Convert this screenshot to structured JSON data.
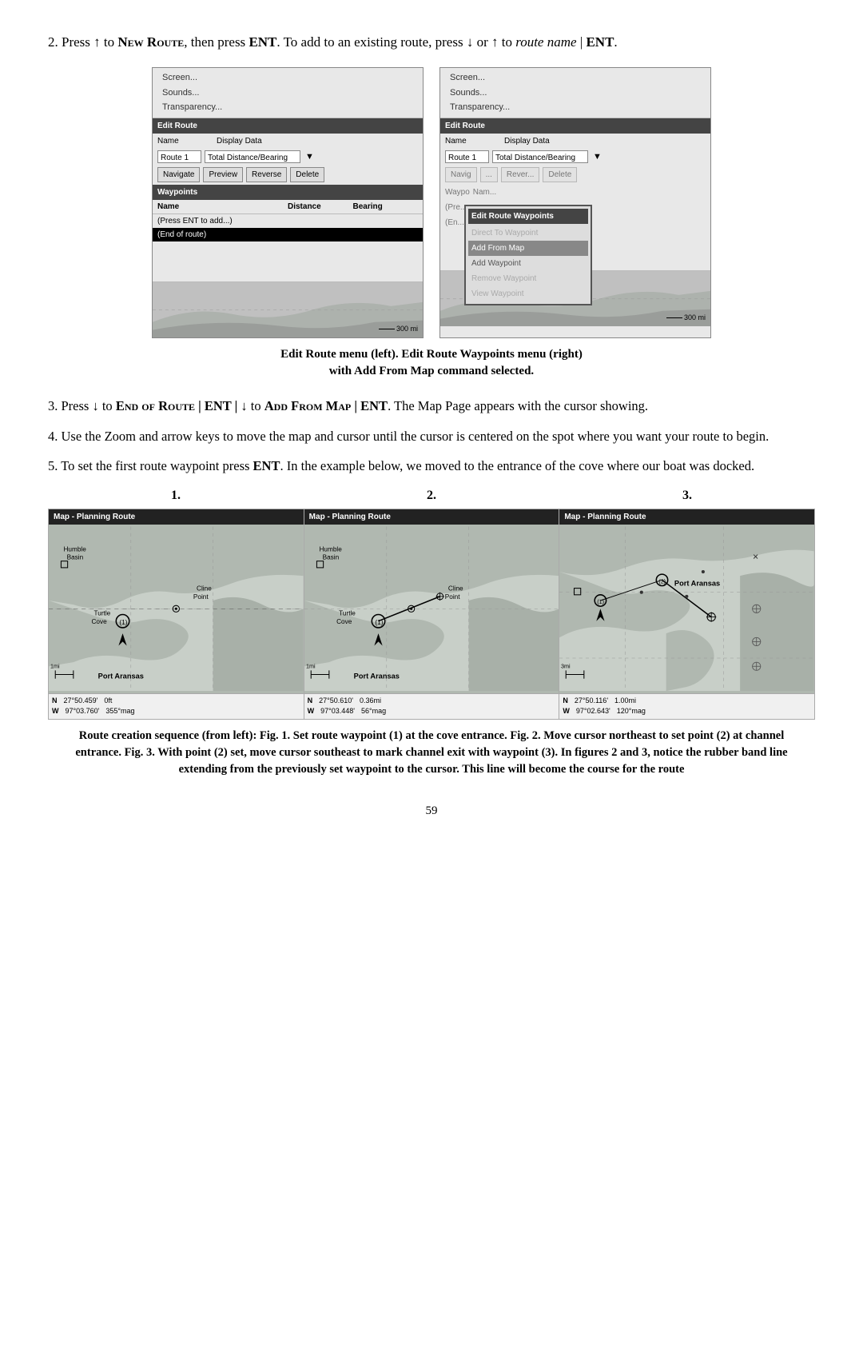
{
  "page": {
    "number": "59"
  },
  "intro": {
    "step2": "2. Press ",
    "step2_key1": "↑",
    "step2_pre": " to ",
    "step2_cmd": "New Route",
    "step2_mid": ", then press ",
    "step2_ent": "ENT",
    "step2_post": ". To add to an existing route, press ",
    "step2_key2": "↓",
    "step2_or": " or ",
    "step2_key3": "↑",
    "step2_final": " to ",
    "step2_route": "route name",
    "step2_bar": " | ",
    "step2_ent2": "ENT",
    "step2_period": "."
  },
  "screens": {
    "left": {
      "menu_items": [
        "Screen...",
        "Sounds...",
        "Transparency..."
      ],
      "section": "Edit Route",
      "name_label": "Name",
      "display_label": "Display Data",
      "route_name": "Route 1",
      "display_value": "Total Distance/Bearing",
      "buttons": [
        "Navigate",
        "Preview",
        "Reverse",
        "Delete"
      ],
      "waypoints_section": "Waypoints",
      "waypoints_cols": [
        "Name",
        "Distance",
        "Bearing"
      ],
      "waypoints_rows": [
        {
          "name": "(Press ENT to add...)",
          "distance": "",
          "bearing": ""
        },
        {
          "name": "(End of route)",
          "distance": "",
          "bearing": "",
          "selected": true
        }
      ],
      "scale": "300 mi"
    },
    "right": {
      "menu_items": [
        "Screen...",
        "Sounds...",
        "Transparency..."
      ],
      "section": "Edit Route",
      "name_label": "Name",
      "display_label": "Display Data",
      "route_name": "Route 1",
      "display_value": "Total Distance/Bearing",
      "buttons": [
        "Navig",
        "....",
        "Rever...",
        "Delete"
      ],
      "popup_title": "Edit Route Waypoints",
      "popup_items": [
        {
          "label": "Direct To Waypoint",
          "type": "disabled"
        },
        {
          "label": "Add From Map",
          "type": "highlighted"
        },
        {
          "label": "Add Waypoint",
          "type": "normal"
        },
        {
          "label": "Remove Waypoint",
          "type": "disabled"
        },
        {
          "label": "View Waypoint",
          "type": "disabled"
        }
      ],
      "scale": "300 mi"
    }
  },
  "screens_caption": {
    "line1": "Edit Route menu (left). Edit Route Waypoints menu (right)",
    "line2": "with Add From Map command selected."
  },
  "steps": {
    "step3": {
      "pre": "3. Press ",
      "key1": "↓",
      "mid": " to ",
      "cmd1": "End of Route",
      "bar1": " | ",
      "ent1": "ENT",
      "bar2": " | ",
      "key2": "↓",
      "mid2": " to ",
      "cmd2": "Add From Map",
      "bar3": " | ",
      "ent2": "ENT",
      "post": ". The Map Page appears with the cursor showing."
    },
    "step4": "4. Use the Zoom and arrow keys to move the map and cursor until the cursor is centered on the spot where you want your route to begin.",
    "step5": {
      "pre": "5. To set the first route waypoint press ",
      "ent": "ENT",
      "post": ". In the example below, we moved to the entrance of the cove where our boat was docked."
    }
  },
  "figures": {
    "labels": [
      "1.",
      "2.",
      "3."
    ],
    "maps": [
      {
        "header": "Map - Planning Route",
        "scale_indicator": "1mi",
        "coords": {
          "lat_label": "N",
          "lat_value": "27°50.459'",
          "lon_label": "W",
          "lon_value": "97°03.760'",
          "val1": "0ft",
          "val2": "355°mag"
        },
        "places": [
          "Humble Basin",
          "Turtle Cove",
          "Cline Point",
          "Port Aransas"
        ],
        "waypoint": "(1)"
      },
      {
        "header": "Map - Planning Route",
        "scale_indicator": "1mi",
        "coords": {
          "lat_label": "N",
          "lat_value": "27°50.610'",
          "lon_label": "W",
          "lon_value": "97°03.448'",
          "val1": "0.36mi",
          "val2": "56°mag"
        },
        "places": [
          "Humble Basin",
          "Turtle Cove",
          "Cline Point",
          "Port Aransas"
        ],
        "waypoint": "(1)"
      },
      {
        "header": "Map - Planning Route",
        "scale_indicator": "3mi",
        "coords": {
          "lat_label": "N",
          "lat_value": "27°50.116'",
          "lon_label": "W",
          "lon_value": "97°02.643'",
          "val1": "1.00mi",
          "val2": "120°mag"
        },
        "places": [
          "Port Aransas"
        ],
        "waypoints": [
          "(2)",
          "(3)"
        ]
      }
    ]
  },
  "figures_caption": {
    "text": "Route creation sequence (from left): Fig. 1. Set route waypoint (1) at the cove entrance. Fig. 2. Move cursor northeast to set point (2) at channel entrance. Fig. 3. With point (2) set, move cursor southeast to mark channel exit with waypoint (3). In figures 2 and 3, notice the rubber band line extending from the previously set waypoint to the cursor. This line will become the course for the route"
  }
}
